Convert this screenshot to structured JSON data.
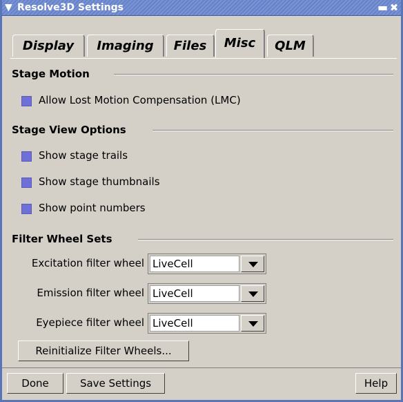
{
  "window": {
    "title": "Resolve3D Settings"
  },
  "tabs": [
    {
      "label": "Display"
    },
    {
      "label": "Imaging"
    },
    {
      "label": "Files"
    },
    {
      "label": "Misc",
      "active": true
    },
    {
      "label": "QLM"
    }
  ],
  "stage_motion": {
    "heading": "Stage Motion",
    "lmc": {
      "label": "Allow Lost Motion Compensation (LMC)",
      "checked": true
    }
  },
  "stage_view": {
    "heading": "Stage View Options",
    "trails": {
      "label": "Show stage trails",
      "checked": true
    },
    "thumbnails": {
      "label": "Show stage thumbnails",
      "checked": true
    },
    "point_numbers": {
      "label": "Show point numbers",
      "checked": true
    }
  },
  "filter_wheels": {
    "heading": "Filter Wheel Sets",
    "excitation": {
      "label": "Excitation filter wheel",
      "value": "LiveCell"
    },
    "emission": {
      "label": "Emission filter wheel",
      "value": "LiveCell"
    },
    "eyepiece": {
      "label": "Eyepiece filter wheel",
      "value": "LiveCell"
    },
    "reinit_label": "Reinitialize Filter Wheels..."
  },
  "footer": {
    "done_label": "Done",
    "save_label": "Save Settings",
    "help_label": "Help"
  },
  "colors": {
    "titlebar": "#6a86cc",
    "check": "#6f6fd8",
    "background": "#d4d0c8"
  }
}
